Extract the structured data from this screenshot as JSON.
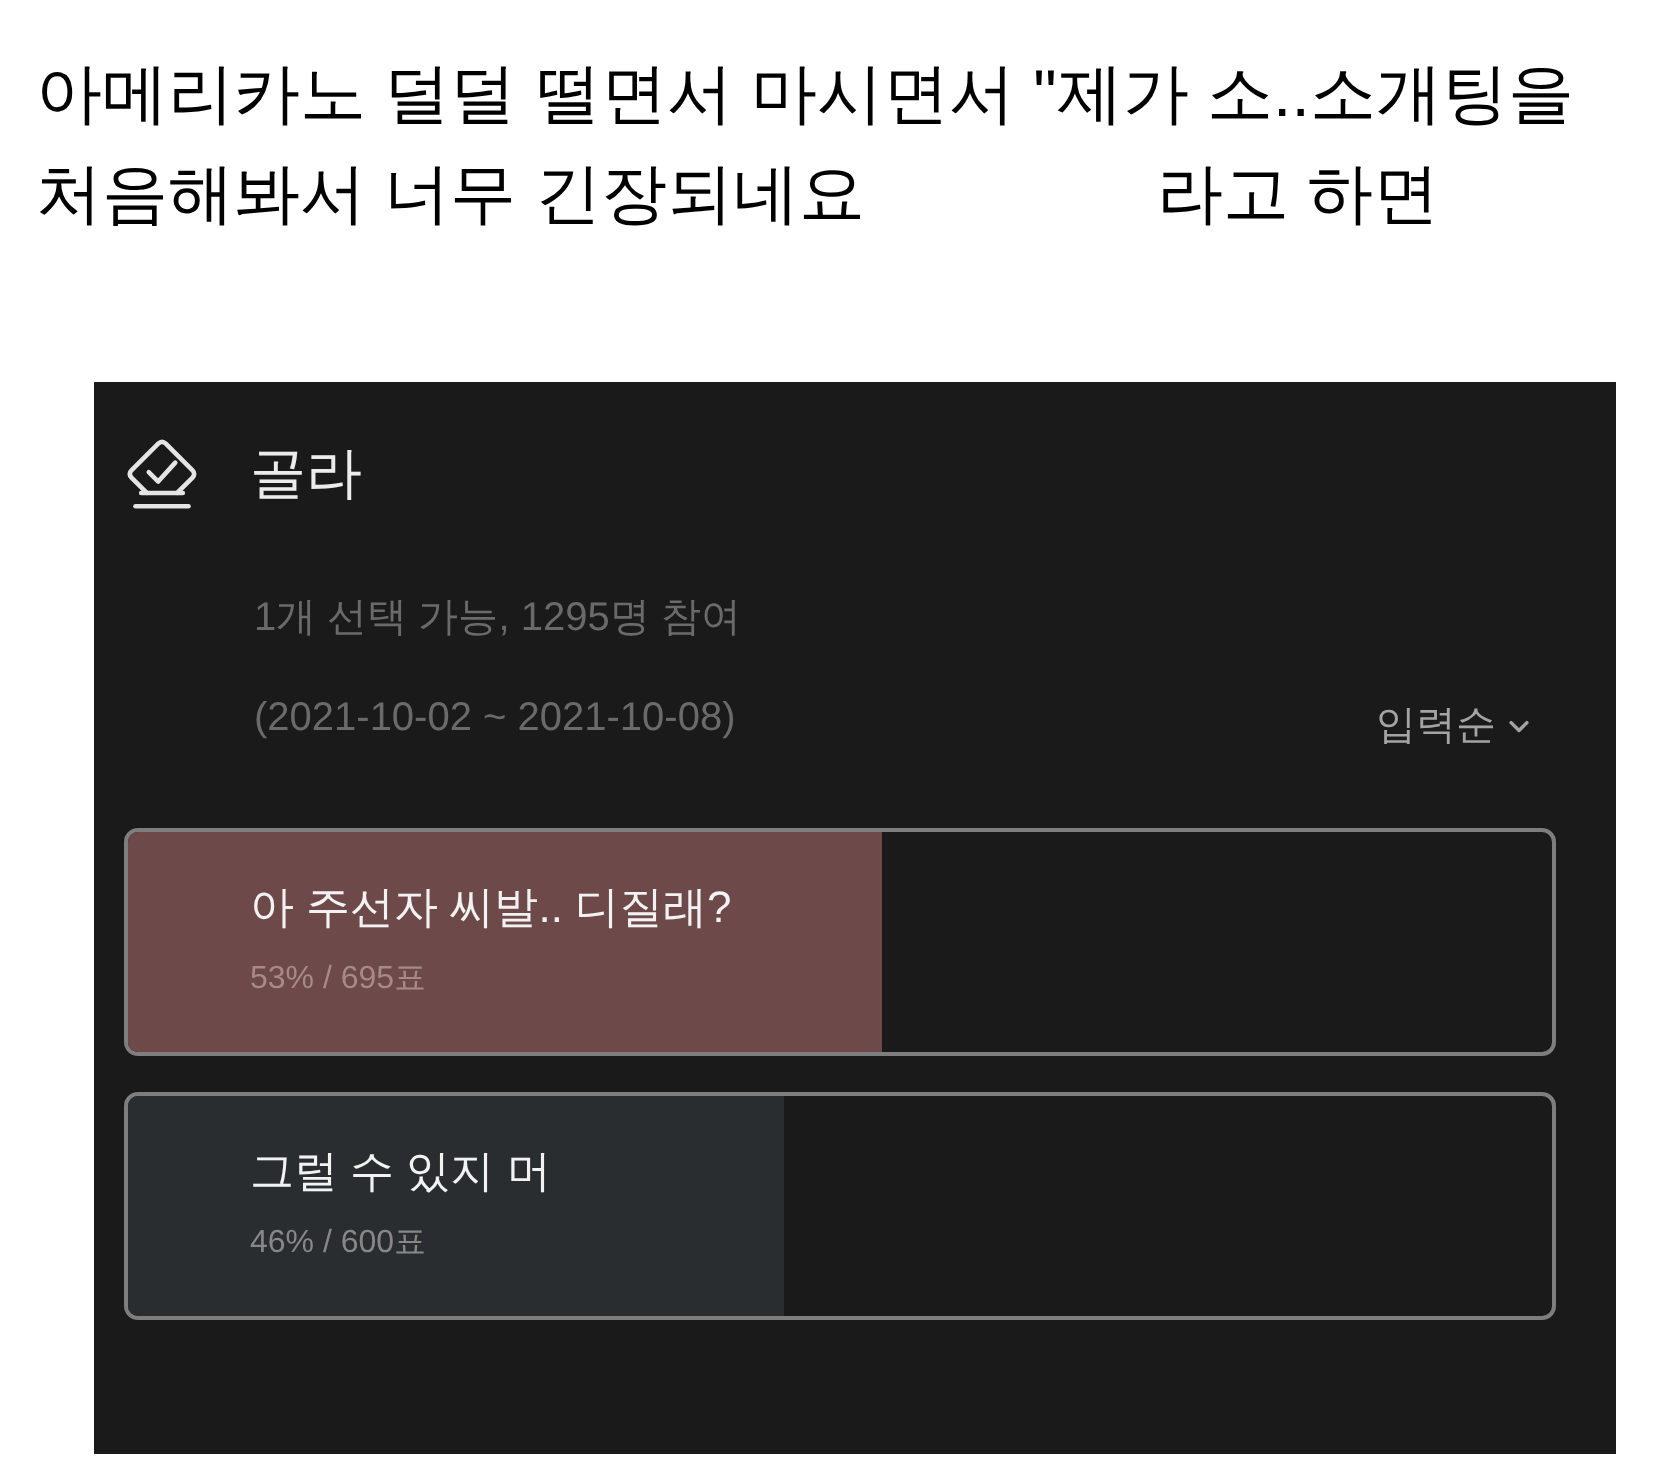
{
  "caption_lines": [
    [
      "아메리카노 덜덜 떨면서 마시면서 \"제가 소..소개팅을"
    ],
    [
      "처음해봐서 너무 긴장되네요",
      "라고 하면"
    ]
  ],
  "poll": {
    "title": "골라",
    "meta": "1개 선택 가능, 1295명 참여",
    "period": "(2021-10-02 ~ 2021-10-08)",
    "sort": "입력순",
    "options": [
      {
        "label": "아 주선자 씨발.. 디질래?",
        "result": "53% / 695표",
        "level": 0.53,
        "leading": true
      },
      {
        "label": "그럴 수 있지 머",
        "result": "46% / 600표",
        "level": 0.46,
        "leading": false
      }
    ]
  }
}
